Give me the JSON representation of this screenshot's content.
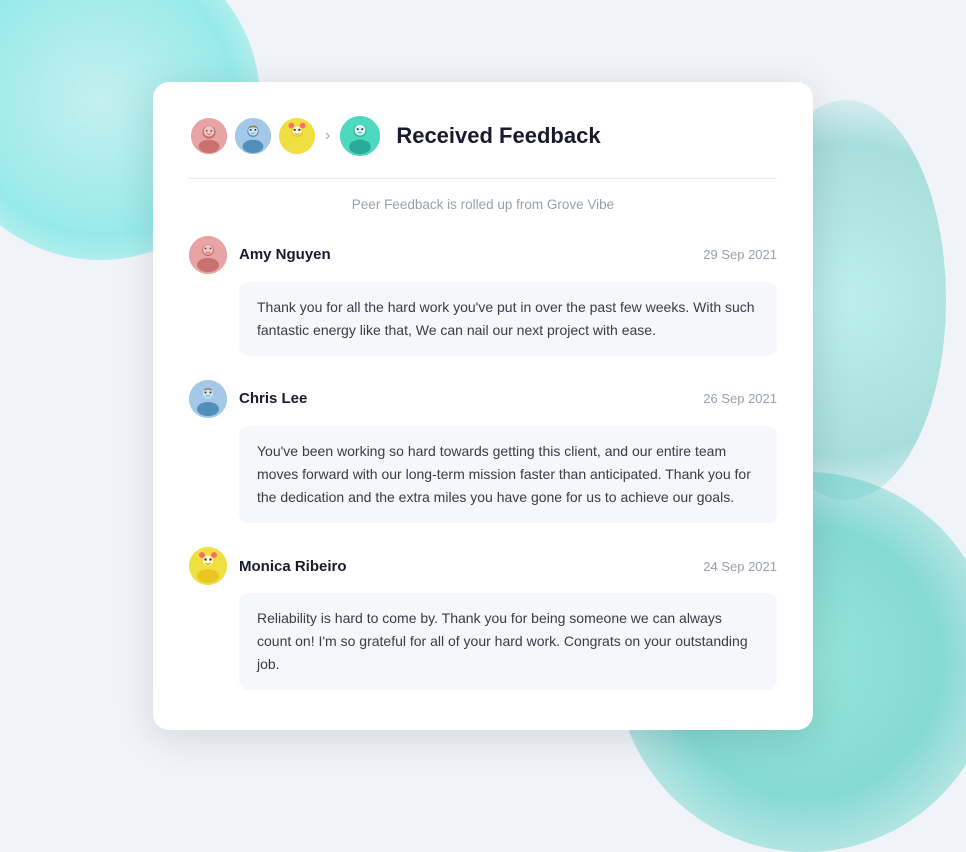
{
  "background": {
    "color": "#e8f7f5"
  },
  "card": {
    "header": {
      "title": "Received Feedback",
      "subtitle": "Peer Feedback is rolled up from Grove Vibe",
      "avatars": {
        "sender1_emoji": "👩",
        "sender2_emoji": "👨",
        "sender3_emoji": "🤩",
        "target_emoji": "🧑"
      },
      "arrow": "›"
    },
    "feedbacks": [
      {
        "id": "1",
        "name": "Amy Nguyen",
        "date": "29 Sep 2021",
        "message": "Thank you for all the hard work you've put in over the past few weeks. With such fantastic energy like that, We can nail our next project with ease.",
        "avatar_type": "amy",
        "avatar_emoji": "👩‍💼"
      },
      {
        "id": "2",
        "name": "Chris Lee",
        "date": "26 Sep 2021",
        "message": "You've been working so hard towards getting this client, and our entire team moves forward with our long-term mission faster than anticipated. Thank you for the dedication and the extra miles you have gone for us to achieve our goals.",
        "avatar_type": "chris",
        "avatar_emoji": "👨‍💼"
      },
      {
        "id": "3",
        "name": "Monica Ribeiro",
        "date": "24 Sep 2021",
        "message": "Reliability is hard to come by. Thank you for being someone we can always count on! I'm so grateful for all of your hard work. Congrats on your outstanding job.",
        "avatar_type": "monica",
        "avatar_emoji": "🤩"
      }
    ]
  }
}
